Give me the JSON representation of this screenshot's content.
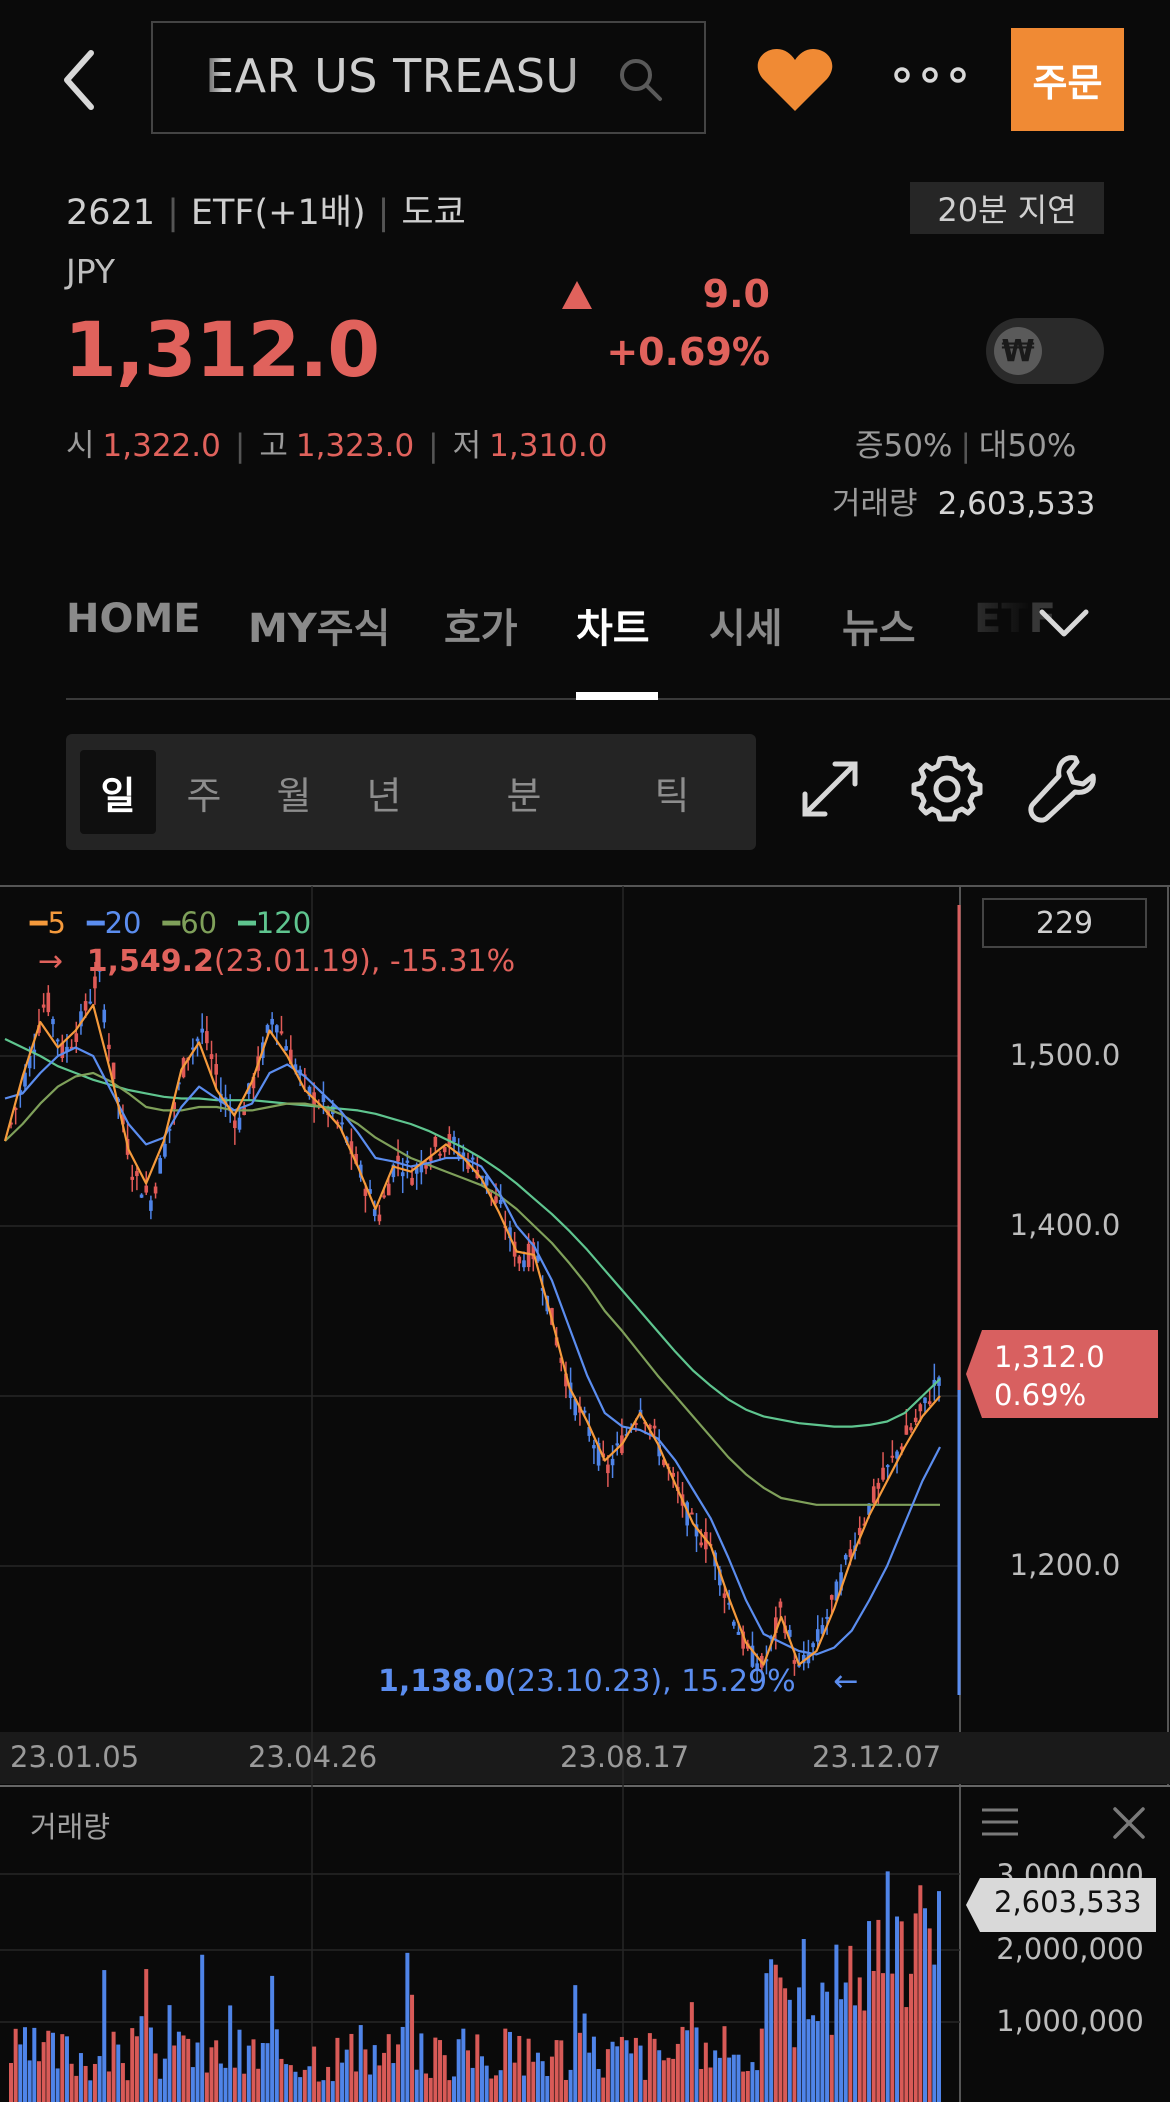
{
  "header": {
    "search_text": "EAR US TREASU",
    "order_label": "주문"
  },
  "info": {
    "code": "2621",
    "type": "ETF(+1배)",
    "market": "도쿄",
    "delay": "20분 지연",
    "currency": "JPY",
    "price": "1,312.0",
    "change": "9.0",
    "change_pct": "+0.69%",
    "toggle_symbol": "₩",
    "open_label": "시",
    "open": "1,322.0",
    "high_label": "고",
    "high": "1,323.0",
    "low_label": "저",
    "low": "1,310.0",
    "margin_label": "증50%",
    "loan_label": "대50%",
    "volume_label": "거래량",
    "volume": "2,603,533"
  },
  "tabs": [
    {
      "label": "HOME"
    },
    {
      "label": "MY주식"
    },
    {
      "label": "호가"
    },
    {
      "label": "차트",
      "active": true
    },
    {
      "label": "시세"
    },
    {
      "label": "뉴스"
    },
    {
      "label": "ETF"
    }
  ],
  "periods": [
    {
      "label": "일",
      "active": true
    },
    {
      "label": "주"
    },
    {
      "label": "월"
    },
    {
      "label": "년"
    },
    {
      "label": "분"
    },
    {
      "label": "틱"
    }
  ],
  "chart": {
    "count": "229",
    "legend": [
      {
        "label": "5",
        "color": "#f59a3c"
      },
      {
        "label": "20",
        "color": "#5b8def"
      },
      {
        "label": "60",
        "color": "#7fa05a"
      },
      {
        "label": "120",
        "color": "#5fc58f"
      }
    ],
    "high_annotation": {
      "arrow": "→",
      "value": "1,549.2",
      "rest": "(23.01.19), -15.31%"
    },
    "low_annotation": {
      "value": "1,138.0",
      "rest": "(23.10.23), 15.29%",
      "arrow": "←"
    },
    "current_tag": {
      "price": "1,312.0",
      "pct": "0.69%"
    },
    "volume_title": "거래량",
    "volume_tag": "2,603,533"
  },
  "chart_data": {
    "type": "candlestick",
    "y_ticks": [
      "1,500.0",
      "1,400.0",
      "1,200.0"
    ],
    "x_ticks": [
      "23.01.05",
      "23.04.26",
      "23.08.17",
      "23.12.07"
    ],
    "ylim": [
      1100,
      1600
    ],
    "volume_ticks": [
      "3,000,000",
      "2,000,000",
      "1,000,000"
    ],
    "price_path": [
      1460,
      1495,
      1535,
      1500,
      1520,
      1549,
      1480,
      1430,
      1415,
      1455,
      1500,
      1515,
      1478,
      1460,
      1490,
      1525,
      1500,
      1478,
      1470,
      1455,
      1430,
      1405,
      1440,
      1430,
      1445,
      1450,
      1440,
      1430,
      1408,
      1380,
      1385,
      1340,
      1300,
      1280,
      1255,
      1275,
      1295,
      1270,
      1245,
      1222,
      1212,
      1178,
      1150,
      1140,
      1175,
      1138,
      1155,
      1180,
      1210,
      1235,
      1255,
      1275,
      1290,
      1312
    ],
    "ma5": [
      1450,
      1488,
      1520,
      1505,
      1515,
      1530,
      1490,
      1445,
      1425,
      1450,
      1492,
      1508,
      1480,
      1465,
      1485,
      1515,
      1500,
      1480,
      1470,
      1458,
      1435,
      1410,
      1435,
      1432,
      1440,
      1448,
      1440,
      1428,
      1408,
      1385,
      1383,
      1345,
      1305,
      1285,
      1262,
      1272,
      1290,
      1272,
      1248,
      1225,
      1212,
      1182,
      1155,
      1142,
      1170,
      1142,
      1150,
      1175,
      1205,
      1230,
      1250,
      1270,
      1288,
      1300
    ],
    "ma20": [
      1475,
      1478,
      1490,
      1500,
      1505,
      1500,
      1480,
      1460,
      1448,
      1452,
      1470,
      1482,
      1475,
      1468,
      1472,
      1490,
      1495,
      1488,
      1478,
      1468,
      1455,
      1440,
      1438,
      1435,
      1437,
      1440,
      1440,
      1435,
      1420,
      1400,
      1388,
      1368,
      1340,
      1312,
      1290,
      1282,
      1280,
      1275,
      1262,
      1245,
      1228,
      1205,
      1180,
      1160,
      1155,
      1150,
      1148,
      1152,
      1162,
      1180,
      1200,
      1225,
      1250,
      1270
    ],
    "ma60": [
      1450,
      1460,
      1472,
      1482,
      1488,
      1490,
      1485,
      1478,
      1470,
      1468,
      1468,
      1470,
      1470,
      1468,
      1468,
      1470,
      1472,
      1472,
      1470,
      1466,
      1460,
      1452,
      1446,
      1440,
      1436,
      1432,
      1428,
      1424,
      1418,
      1410,
      1400,
      1390,
      1378,
      1365,
      1350,
      1338,
      1325,
      1312,
      1300,
      1288,
      1276,
      1264,
      1254,
      1246,
      1240,
      1238,
      1236,
      1236,
      1236,
      1236,
      1236,
      1236,
      1236,
      1236
    ],
    "ma120": [
      1510,
      1505,
      1500,
      1494,
      1490,
      1486,
      1483,
      1480,
      1478,
      1476,
      1475,
      1475,
      1474,
      1474,
      1474,
      1473,
      1472,
      1471,
      1470,
      1469,
      1468,
      1466,
      1463,
      1460,
      1456,
      1451,
      1446,
      1440,
      1433,
      1425,
      1416,
      1407,
      1397,
      1386,
      1374,
      1362,
      1350,
      1338,
      1326,
      1315,
      1306,
      1298,
      1292,
      1288,
      1286,
      1284,
      1283,
      1282,
      1282,
      1283,
      1285,
      1290,
      1300,
      1310
    ]
  }
}
